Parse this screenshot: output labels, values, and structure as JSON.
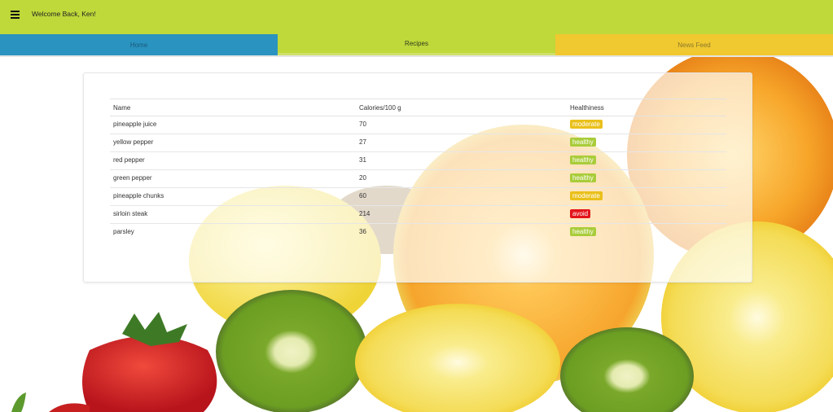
{
  "header": {
    "welcome_text": "Welcome Back, Ken!",
    "menu_icon": "menu-icon"
  },
  "tabs": [
    {
      "label": "Home",
      "color": "#2a93bf"
    },
    {
      "label": "Recipes",
      "color": "#bfd83a"
    },
    {
      "label": "News Feed",
      "color": "#f0c830"
    }
  ],
  "table": {
    "headers": [
      "Name",
      "Calories/100 g",
      "Healthiness"
    ],
    "rows": [
      {
        "name": "pineapple juice",
        "calories": "70",
        "health": "moderate"
      },
      {
        "name": "yellow pepper",
        "calories": "27",
        "health": "healthy"
      },
      {
        "name": "red pepper",
        "calories": "31",
        "health": "healthy"
      },
      {
        "name": "green pepper",
        "calories": "20",
        "health": "healthy"
      },
      {
        "name": "pineapple chunks",
        "calories": "60",
        "health": "moderate"
      },
      {
        "name": "sirloin steak",
        "calories": "214",
        "health": "avoid"
      },
      {
        "name": "parsley",
        "calories": "36",
        "health": "healthy"
      }
    ]
  },
  "badge_colors": {
    "moderate": "#eac01c",
    "healthy": "#a9cc3a",
    "avoid": "#e3141b"
  }
}
